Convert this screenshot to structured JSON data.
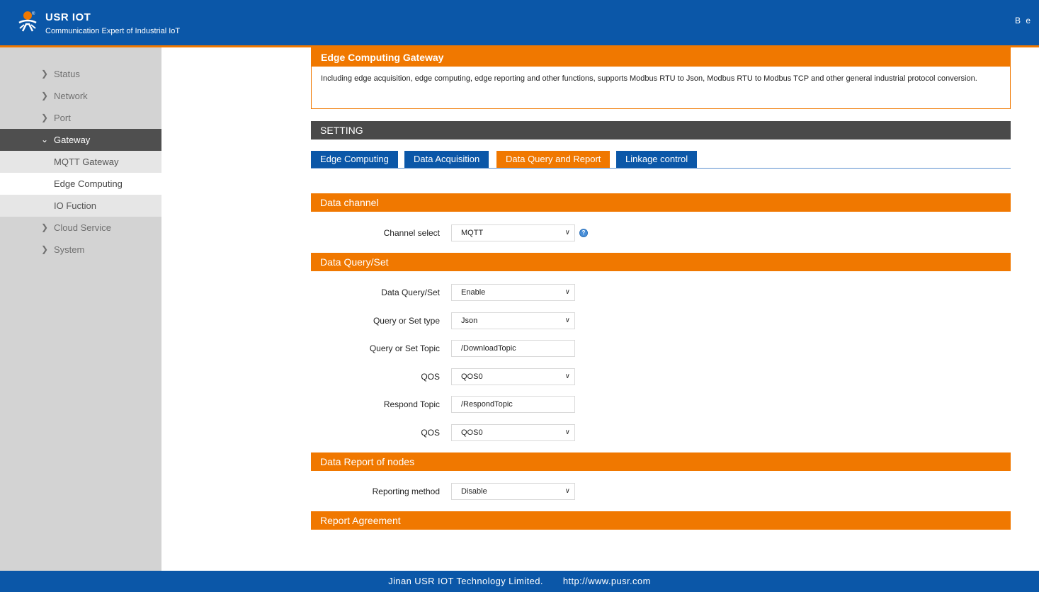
{
  "header": {
    "brand": "USR IOT",
    "tagline": "Communication Expert of Industrial IoT",
    "language": "B e",
    "logo_icon": "usr-logo-icon",
    "accent_color": "#f07800",
    "primary_color": "#0b57a8"
  },
  "sidebar": {
    "items": [
      {
        "label": "Status",
        "icon": "chevron-right-icon"
      },
      {
        "label": "Network",
        "icon": "chevron-right-icon"
      },
      {
        "label": "Port",
        "icon": "chevron-right-icon"
      },
      {
        "label": "Gateway",
        "icon": "chevron-down-icon"
      },
      {
        "label": "Cloud Service",
        "icon": "chevron-right-icon"
      },
      {
        "label": "System",
        "icon": "chevron-right-icon"
      }
    ],
    "gateway_sub": [
      "MQTT Gateway",
      "Edge Computing",
      "IO Fuction"
    ]
  },
  "info": {
    "title": "Edge Computing Gateway",
    "text": "Including edge acquisition, edge computing, edge reporting and other functions, supports Modbus RTU to Json, Modbus RTU to Modbus TCP and other general industrial protocol conversion."
  },
  "setting": {
    "label": "SETTING"
  },
  "tabs": [
    "Edge Computing",
    "Data Acquisition",
    "Data Query and Report",
    "Linkage control"
  ],
  "sections": {
    "data_channel": "Data channel",
    "data_query_set": "Data Query/Set",
    "data_report": "Data Report of nodes",
    "report_agreement": "Report Agreement"
  },
  "form": {
    "channel_select": {
      "label": "Channel select",
      "value": "MQTT"
    },
    "data_query_set": {
      "label": "Data Query/Set",
      "value": "Enable"
    },
    "query_set_type": {
      "label": "Query or Set type",
      "value": "Json"
    },
    "query_set_topic": {
      "label": "Query or Set Topic",
      "value": "/DownloadTopic"
    },
    "qos1": {
      "label": "QOS",
      "value": "QOS0"
    },
    "respond_topic": {
      "label": "Respond Topic",
      "value": "/RespondTopic"
    },
    "qos2": {
      "label": "QOS",
      "value": "QOS0"
    },
    "reporting_method": {
      "label": "Reporting method",
      "value": "Disable"
    }
  },
  "footer": {
    "company": "Jinan USR IOT Technology Limited.",
    "url": "http://www.pusr.com"
  }
}
